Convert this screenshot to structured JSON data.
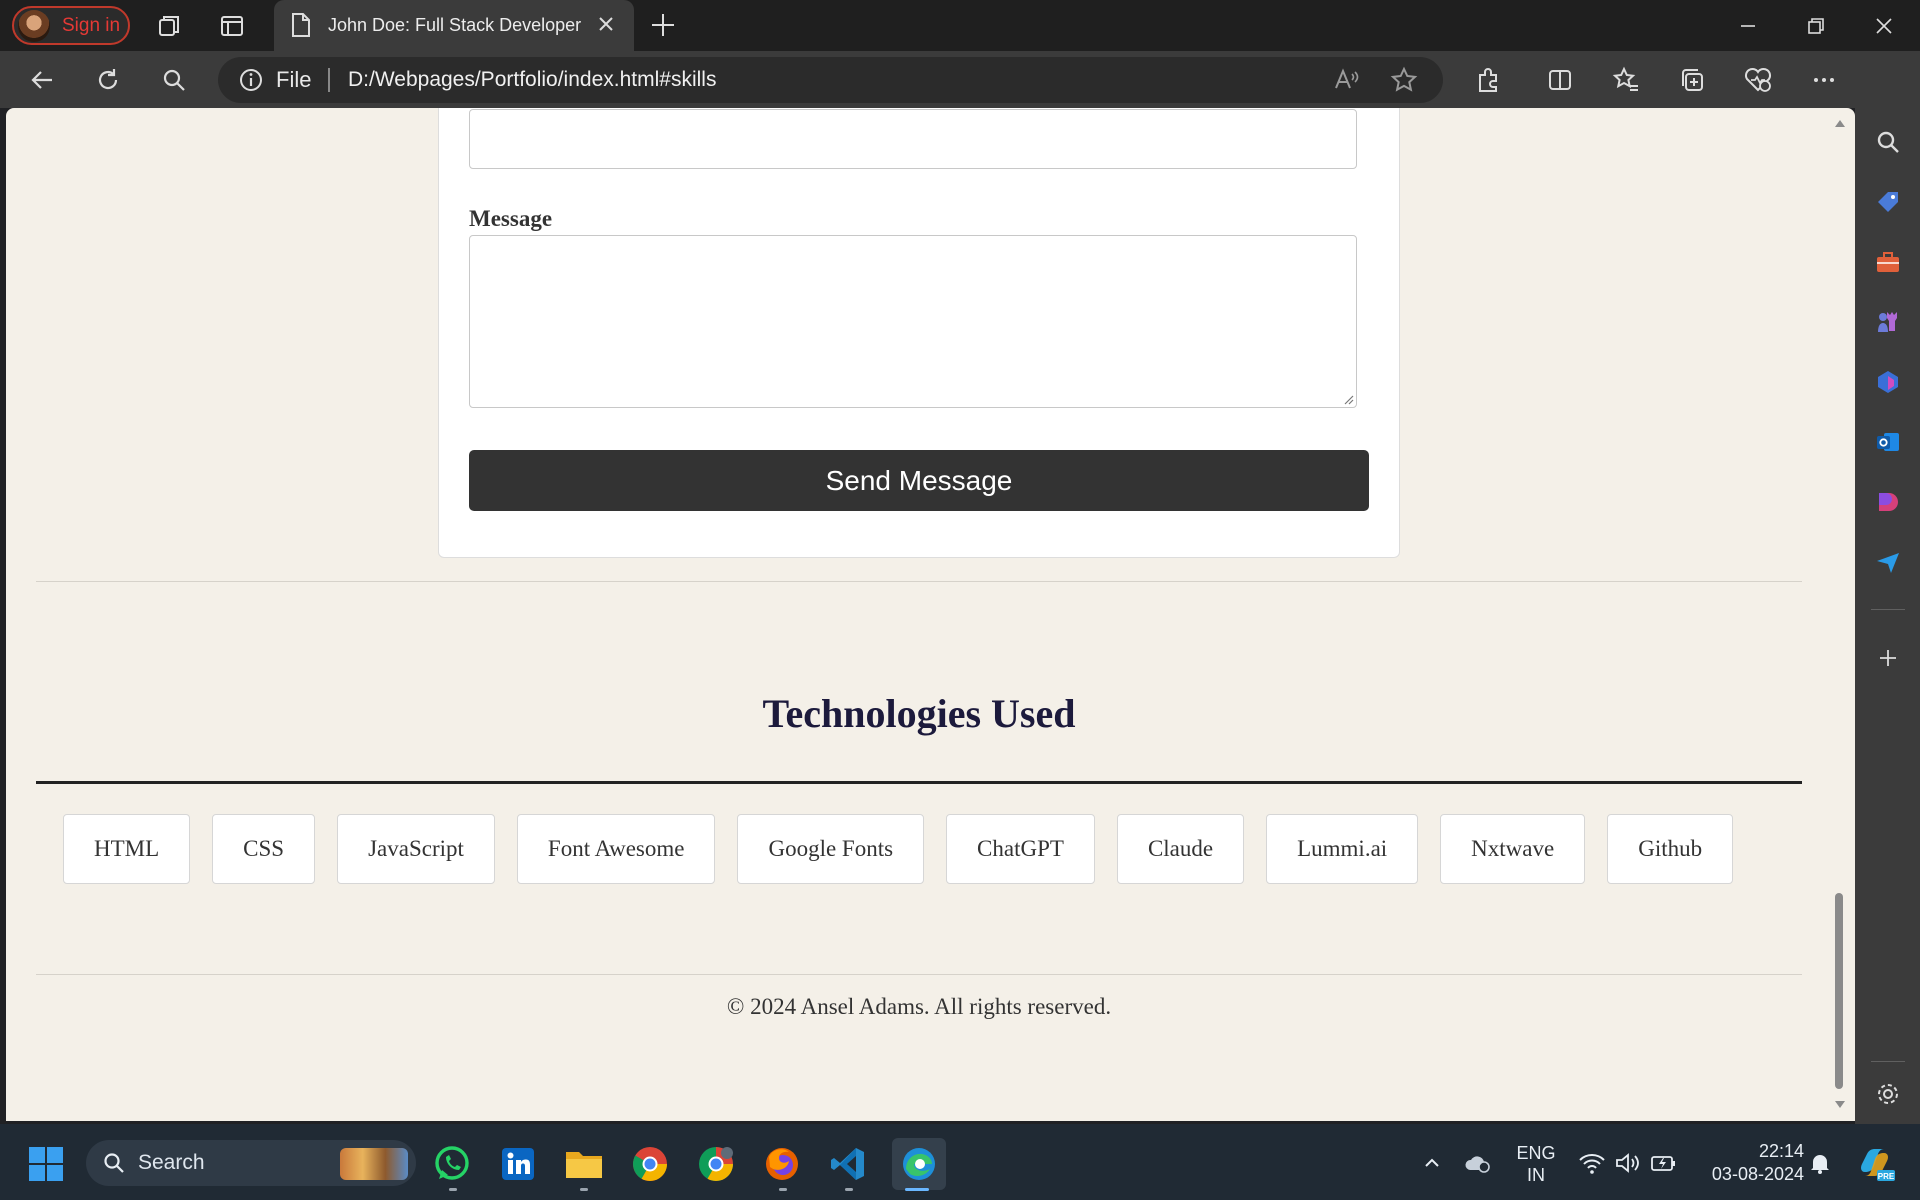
{
  "browser": {
    "profile_label": "Sign in",
    "tab_title": "John Doe: Full Stack Developer",
    "site_info_label": "File",
    "url": "D:/Webpages/Portfolio/index.html#skills"
  },
  "page": {
    "message_label": "Message",
    "send_button_label": "Send Message",
    "tech_title": "Technologies Used",
    "technologies": [
      "HTML",
      "CSS",
      "JavaScript",
      "Font Awesome",
      "Google Fonts",
      "ChatGPT",
      "Claude",
      "Lummi.ai",
      "Nxtwave",
      "Github"
    ],
    "copyright": "© 2024 Ansel Adams. All rights reserved."
  },
  "taskbar": {
    "search_placeholder": "Search",
    "apps": [
      "whatsapp",
      "linkedin",
      "file-explorer",
      "chrome",
      "chrome-profile",
      "firefox",
      "vscode",
      "edge"
    ],
    "language_line1": "ENG",
    "language_line2": "IN",
    "time": "22:14",
    "date": "03-08-2024"
  },
  "colors": {
    "page_background": "#f4f0e8",
    "button_dark": "#333333",
    "title_color": "#1c1a3c",
    "profile_accent": "#e53935"
  }
}
